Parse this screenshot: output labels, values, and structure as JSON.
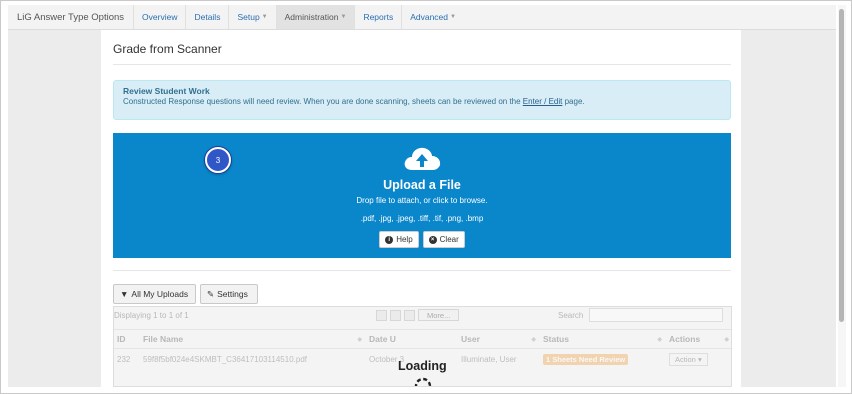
{
  "nav": {
    "brand": "LiG Answer Type Options",
    "items": [
      {
        "label": "Overview",
        "caret": false
      },
      {
        "label": "Details",
        "caret": false
      },
      {
        "label": "Setup",
        "caret": true
      },
      {
        "label": "Administration",
        "caret": true,
        "active": true
      },
      {
        "label": "Reports",
        "caret": false
      },
      {
        "label": "Advanced",
        "caret": true
      }
    ]
  },
  "page": {
    "title": "Grade from Scanner"
  },
  "info": {
    "title": "Review Student Work",
    "text_before": "Constructed Response questions will need review. When you are done scanning, sheets can be reviewed on the ",
    "link": "Enter / Edit",
    "text_after": " page."
  },
  "upload": {
    "title": "Upload a File",
    "subtitle": "Drop file to attach, or click to browse.",
    "file_types": ".pdf, .jpg, .jpeg, .tiff, .tif, .png, .bmp",
    "help_label": "Help",
    "clear_label": "Clear",
    "background": "#0a86cb"
  },
  "step_badge": "3",
  "tabs": {
    "all_uploads": "All My Uploads",
    "settings": "Settings"
  },
  "table": {
    "displaying": "Displaying 1 to 1 of 1",
    "more_label": "More...",
    "search_label": "Search",
    "columns": [
      "ID",
      "File Name",
      "Date U",
      "User",
      "Status",
      "Actions"
    ],
    "rows": [
      {
        "id": "232",
        "file_name": "59f8f5bf024e4SKMBT_C36417103114510.pdf",
        "date": "October 3",
        "user": "Illuminate, User",
        "status": "1 Sheets Need Review",
        "action": "Action"
      }
    ],
    "loading_text": "Loading"
  },
  "colors": {
    "status_badge": "#f0a040",
    "step_badge": "#2f57c8",
    "info_bg": "#d9edf7"
  }
}
